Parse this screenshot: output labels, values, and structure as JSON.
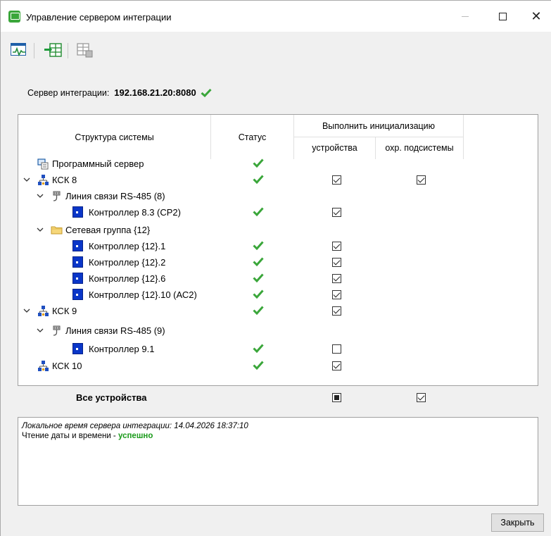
{
  "window": {
    "title": "Управление сервером интеграции"
  },
  "server": {
    "label": "Сервер интеграции:",
    "address": "192.168.21.20:8080"
  },
  "table": {
    "headers": {
      "structure": "Структура системы",
      "status": "Статус",
      "init_group": "Выполнить инициализацию",
      "devices": "устройства",
      "subsystems": "охр. подсистемы"
    },
    "rows": [
      {
        "label": "Программный сервер",
        "status_ok": true
      },
      {
        "label": "КСК 8",
        "status_ok": true,
        "devices": true,
        "subsystems": true
      },
      {
        "label": "Линия связи RS-485 (8)"
      },
      {
        "label": "Контроллер 8.3 (СР2)",
        "status_ok": true,
        "devices": true
      },
      {
        "label": "Сетевая группа {12}"
      },
      {
        "label": "Контроллер {12}.1",
        "status_ok": true,
        "devices": true
      },
      {
        "label": "Контроллер {12}.2",
        "status_ok": true,
        "devices": true
      },
      {
        "label": "Контроллер {12}.6",
        "status_ok": true,
        "devices": true
      },
      {
        "label": "Контроллер {12}.10 (АС2)",
        "status_ok": true,
        "devices": true
      },
      {
        "label": "КСК 9",
        "status_ok": true,
        "devices": true
      },
      {
        "label": "Линия связи RS-485 (9)"
      },
      {
        "label": "Контроллер 9.1",
        "status_ok": true,
        "devices": false
      },
      {
        "label": "КСК 10",
        "status_ok": true,
        "devices": true
      }
    ],
    "totals": {
      "label": "Все устройства",
      "devices": "indeterminate",
      "subsystems": true
    }
  },
  "log": {
    "line1": "Локальное время сервера интеграции: 14.04.2026 18:37:10",
    "line2_prefix": "Чтение даты и времени - ",
    "line2_status": "успешно"
  },
  "buttons": {
    "close": "Закрыть"
  },
  "colors": {
    "ok_green": "#3aa63a",
    "controller_blue": "#0a36c8",
    "success_text": "#1a9a1a"
  },
  "icons": {
    "toolbar": [
      "monitor-refresh-icon",
      "import-table-icon",
      "export-table-icon"
    ],
    "tree": [
      "server-icon",
      "network-icon",
      "rs485-line-icon",
      "controller-icon",
      "folder-icon",
      "chevron-down-icon",
      "check-icon"
    ]
  }
}
